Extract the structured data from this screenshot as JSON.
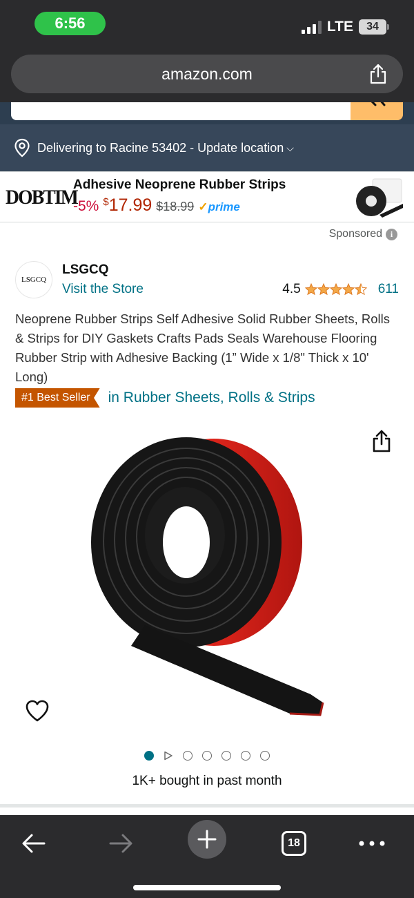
{
  "status_bar": {
    "time": "6:56",
    "network": "LTE",
    "battery": "34"
  },
  "browser": {
    "url": "amazon.com",
    "tab_count": "18"
  },
  "delivery": {
    "text": "Delivering to Racine 53402 - Update location"
  },
  "sponsored_ad": {
    "brand_logo": "DOBTIM",
    "title": "Adhesive Neoprene Rubber Strips",
    "discount": "-5%",
    "price_symbol": "$",
    "price": "17.99",
    "list_price": "$18.99",
    "prime_label": "prime"
  },
  "sponsored_label": "Sponsored",
  "store": {
    "logo_text": "LSGCQ",
    "brand": "LSGCQ",
    "visit_label": "Visit the Store"
  },
  "rating": {
    "value": "4.5",
    "stars": 4.5,
    "count": "611"
  },
  "product": {
    "title": "Neoprene Rubber Strips Self Adhesive Solid Rubber Sheets, Rolls & Strips for DIY Gaskets Crafts Pads Seals Warehouse Flooring Rubber Strip with Adhesive Backing (1” Wide x 1/8\" Thick x 10' Long)",
    "badge": "#1 Best Seller",
    "badge_category": "in Rubber Sheets, Rolls & Strips",
    "bought_text": "1K+ bought in past month",
    "image_count": 7,
    "active_image": 1
  },
  "colors": {
    "link": "#007185",
    "price": "#b12704",
    "badge": "#c45500",
    "delivery_bar": "#37475a",
    "chrome": "#2b2b2d"
  }
}
